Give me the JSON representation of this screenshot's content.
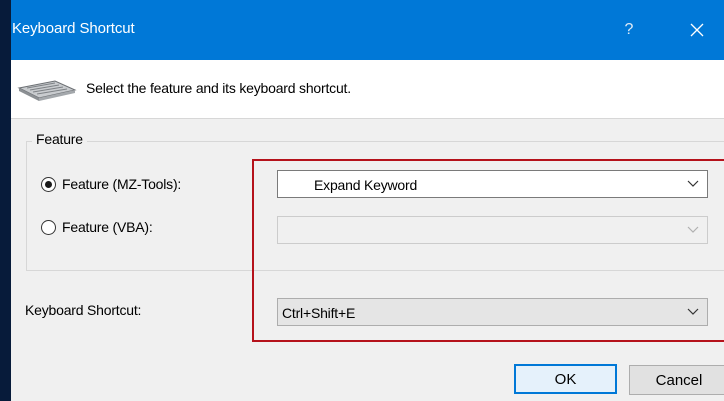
{
  "window": {
    "title": "Keyboard Shortcut",
    "help_glyph": "?",
    "title_bar_color": "#0078d7"
  },
  "header": {
    "icon": "keyboard-icon",
    "instruction": "Select the feature and its keyboard shortcut."
  },
  "feature_group": {
    "legend": "Feature",
    "options": [
      {
        "label": "Feature (MZ-Tools):",
        "checked": true,
        "value": "Expand Keyword",
        "enabled": true
      },
      {
        "label": "Feature (VBA):",
        "checked": false,
        "value": "",
        "enabled": false
      }
    ]
  },
  "shortcut": {
    "label": "Keyboard Shortcut:",
    "value": "Ctrl+Shift+E"
  },
  "annotation": {
    "highlight_color": "#b5121b"
  },
  "buttons": {
    "ok": "OK",
    "cancel": "Cancel"
  }
}
